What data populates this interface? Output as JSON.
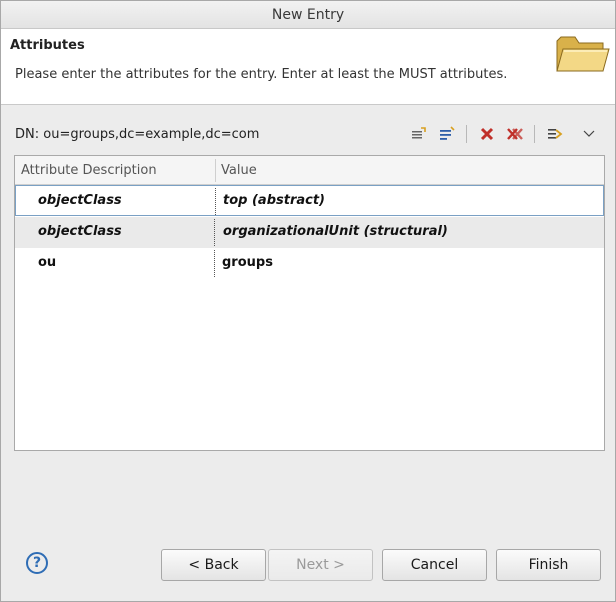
{
  "window": {
    "title": "New Entry"
  },
  "header": {
    "title": "Attributes",
    "description": "Please enter the attributes for the entry. Enter at least the MUST attributes."
  },
  "dn": {
    "label": "DN: ou=groups,dc=example,dc=com"
  },
  "toolbar": {
    "icons": [
      "new-attribute-icon",
      "new-value-icon",
      "delete-icon",
      "delete-all-icon",
      "expand-icon",
      "view-menu-icon"
    ]
  },
  "table": {
    "columns": [
      "Attribute Description",
      "Value"
    ],
    "rows": [
      {
        "attribute": "objectClass",
        "value": "top (abstract)"
      },
      {
        "attribute": "objectClass",
        "value": "organizationalUnit (structural)"
      },
      {
        "attribute": "ou",
        "value": "groups"
      }
    ]
  },
  "buttons": {
    "back": "< Back",
    "next": "Next >",
    "cancel": "Cancel",
    "finish": "Finish"
  },
  "colors": {
    "help": "#2f6db5",
    "delete": "#c0302a",
    "selection_border": "#7aa0c4"
  }
}
